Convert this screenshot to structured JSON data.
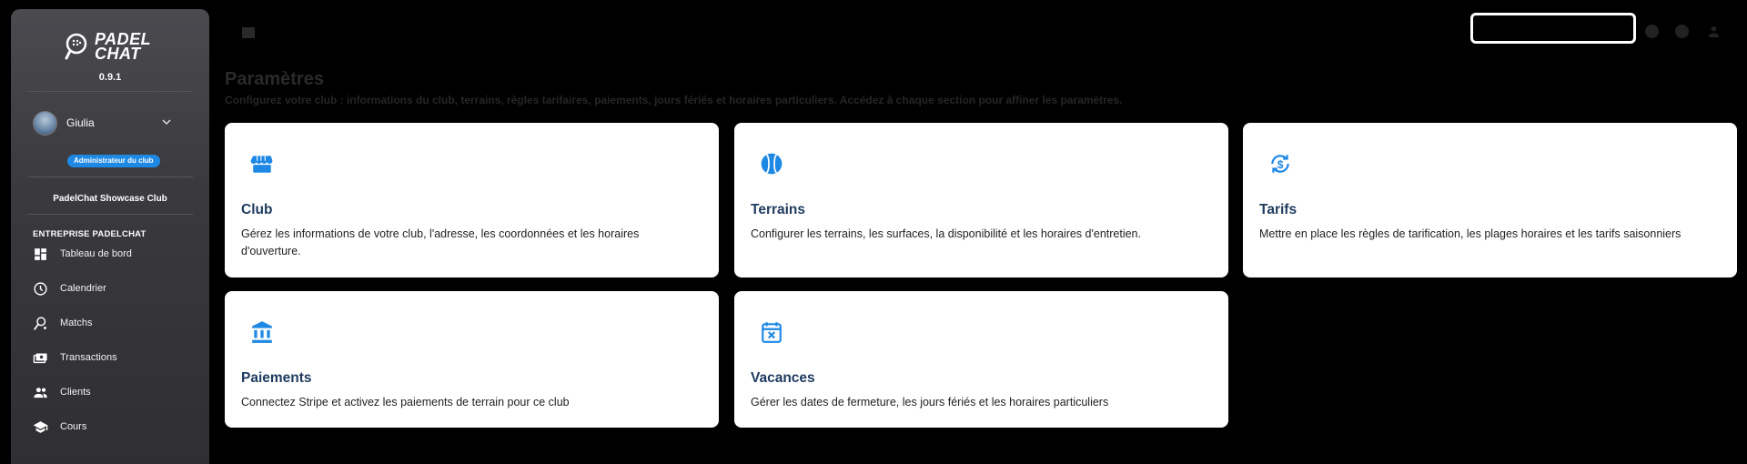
{
  "app": {
    "brand_line1": "PADEL",
    "brand_line2": "CHAT",
    "version": "0.9.1"
  },
  "user": {
    "name": "Giulia",
    "role": "Administrateur du club",
    "club": "PadelChat Showcase Club"
  },
  "sidebar": {
    "section": "ENTREPRISE PADELCHAT",
    "items": [
      {
        "label": "Tableau de bord",
        "icon": "dashboard-icon"
      },
      {
        "label": "Calendrier",
        "icon": "clock-icon"
      },
      {
        "label": "Matchs",
        "icon": "racket-icon"
      },
      {
        "label": "Transactions",
        "icon": "cash-icon"
      },
      {
        "label": "Clients",
        "icon": "people-icon"
      },
      {
        "label": "Cours",
        "icon": "school-icon"
      }
    ]
  },
  "page": {
    "title": "Paramètres",
    "subtitle": "Configurez votre club : informations du club, terrains, règles tarifaires, paiements, jours fériés et horaires particuliers. Accédez à chaque section pour affiner les paramètres."
  },
  "cards": [
    {
      "title": "Club",
      "description": "Gérez les informations de votre club, l'adresse, les coordonnées et les horaires d'ouverture.",
      "icon": "storefront-icon"
    },
    {
      "title": "Terrains",
      "description": "Configurer les terrains, les surfaces, la disponibilité et les horaires d'entretien.",
      "icon": "ball-icon"
    },
    {
      "title": "Tarifs",
      "description": "Mettre en place les règles de tarification, les plages horaires et les tarifs saisonniers",
      "icon": "currency-exchange-icon"
    },
    {
      "title": "Paiements",
      "description": "Connectez Stripe et activez les paiements de terrain pour ce club",
      "icon": "bank-icon"
    },
    {
      "title": "Vacances",
      "description": "Gérer les dates de fermeture, les jours fériés et les horaires particuliers",
      "icon": "event-busy-icon"
    }
  ],
  "colors": {
    "accent": "#1e88e5",
    "card_title": "#1e3a5f",
    "sidebar_bg": "#3a3a3e"
  }
}
